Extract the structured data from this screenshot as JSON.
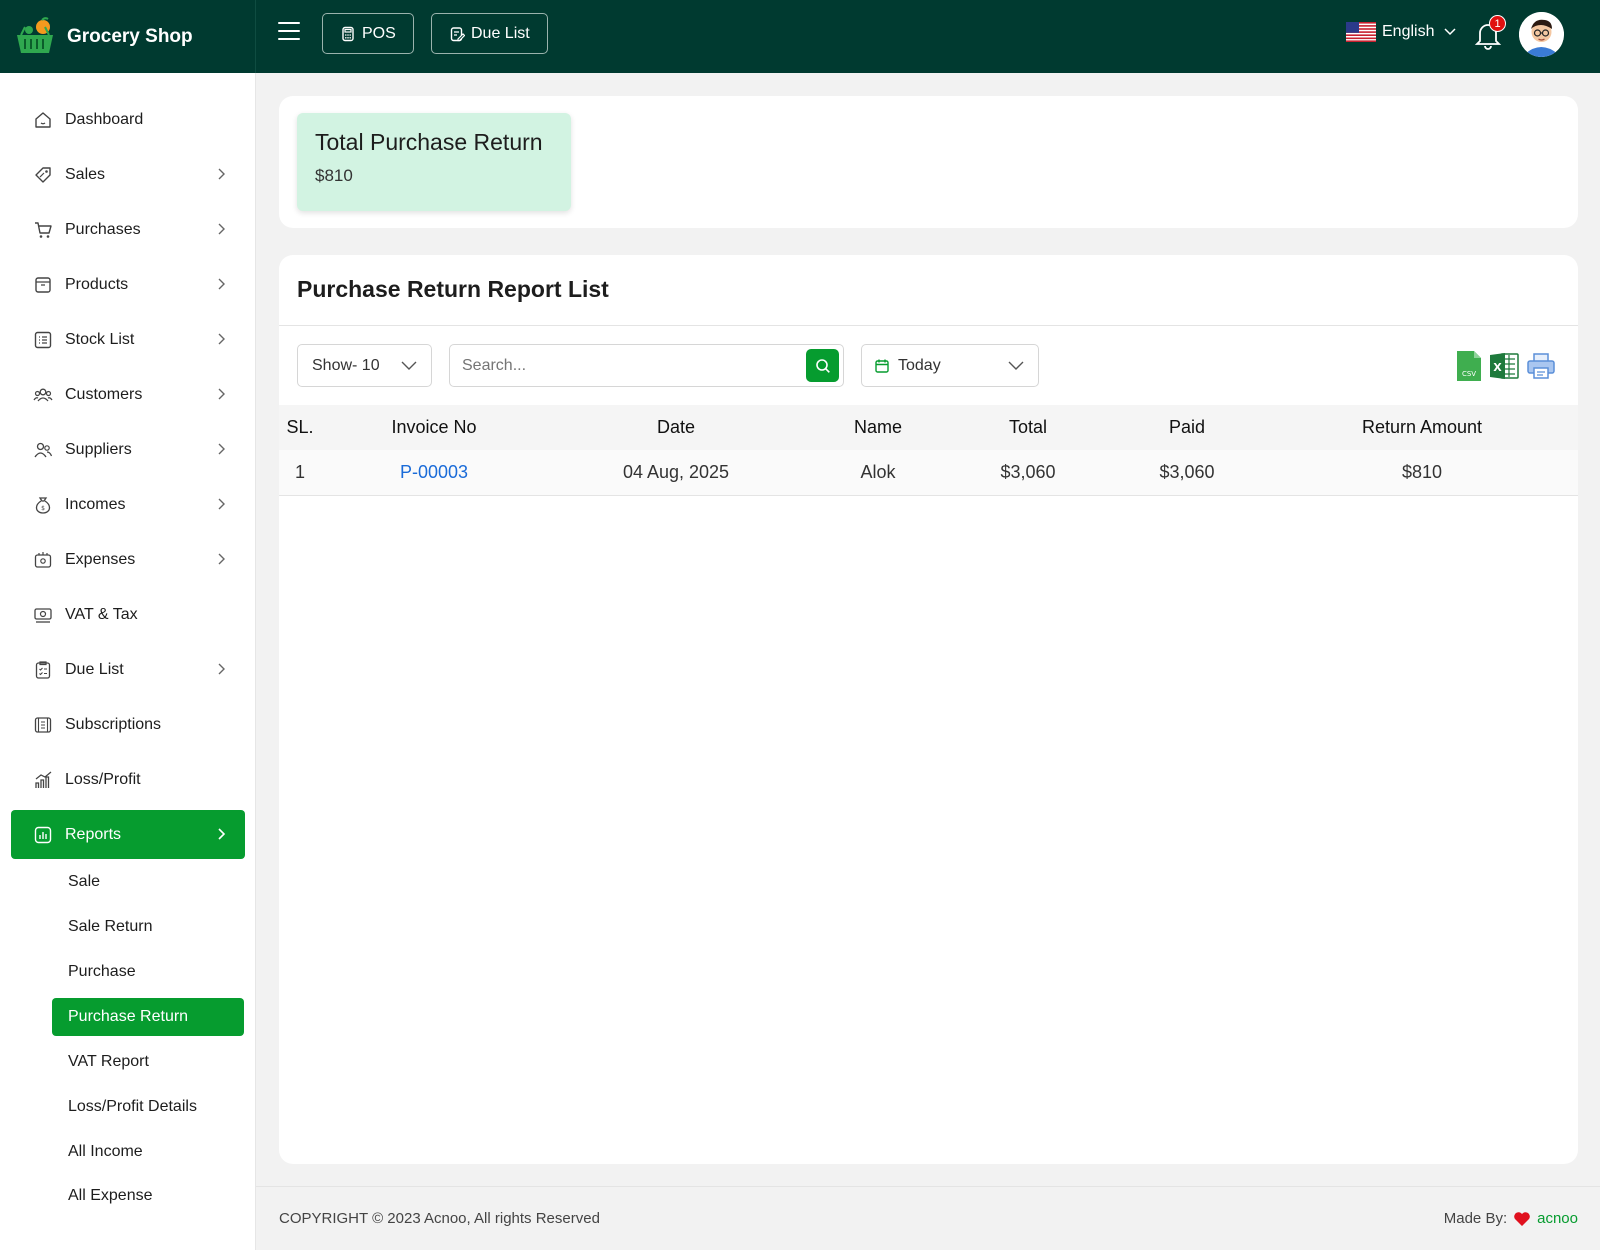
{
  "app": {
    "name": "Grocery Shop"
  },
  "topbar": {
    "pos_label": "POS",
    "due_list_label": "Due List",
    "language": "English",
    "notification_count": "1"
  },
  "sidebar": {
    "items": [
      {
        "label": "Dashboard",
        "icon": "dashboard-icon"
      },
      {
        "label": "Sales",
        "icon": "tag-icon"
      },
      {
        "label": "Purchases",
        "icon": "cart-icon"
      },
      {
        "label": "Products",
        "icon": "box-icon"
      },
      {
        "label": "Stock List",
        "icon": "list-icon"
      },
      {
        "label": "Customers",
        "icon": "users-icon"
      },
      {
        "label": "Suppliers",
        "icon": "supplier-icon"
      },
      {
        "label": "Incomes",
        "icon": "money-bag-icon"
      },
      {
        "label": "Expenses",
        "icon": "wallet-icon"
      },
      {
        "label": "VAT & Tax",
        "icon": "cash-icon"
      },
      {
        "label": "Due List",
        "icon": "clipboard-icon"
      },
      {
        "label": "Subscriptions",
        "icon": "subscription-icon"
      },
      {
        "label": "Loss/Profit",
        "icon": "chart-icon"
      },
      {
        "label": "Reports",
        "icon": "report-icon"
      }
    ],
    "report_subitems": [
      "Sale",
      "Sale Return",
      "Purchase",
      "Purchase Return",
      "VAT Report",
      "Loss/Profit Details",
      "All Income",
      "All Expense"
    ]
  },
  "summary": {
    "title": "Total Purchase Return",
    "value": "$810"
  },
  "report": {
    "title": "Purchase Return Report List",
    "show_label": "Show- 10",
    "search_placeholder": "Search...",
    "date_filter": "Today",
    "columns": [
      "SL.",
      "Invoice No",
      "Date",
      "Name",
      "Total",
      "Paid",
      "Return Amount"
    ],
    "rows": [
      {
        "sl": "1",
        "invoice": "P-00003",
        "date": "04 Aug, 2025",
        "name": "Alok",
        "total": "$3,060",
        "paid": "$3,060",
        "return_amount": "$810"
      }
    ]
  },
  "footer": {
    "copyright": "COPYRIGHT © 2023 Acnoo, All rights Reserved",
    "made_by": "Made By:",
    "brand": "acnoo"
  },
  "colors": {
    "topbar": "#003a30",
    "accent": "#069c2f",
    "summary_bg": "#d2f3e2",
    "link": "#1a6bd8"
  }
}
